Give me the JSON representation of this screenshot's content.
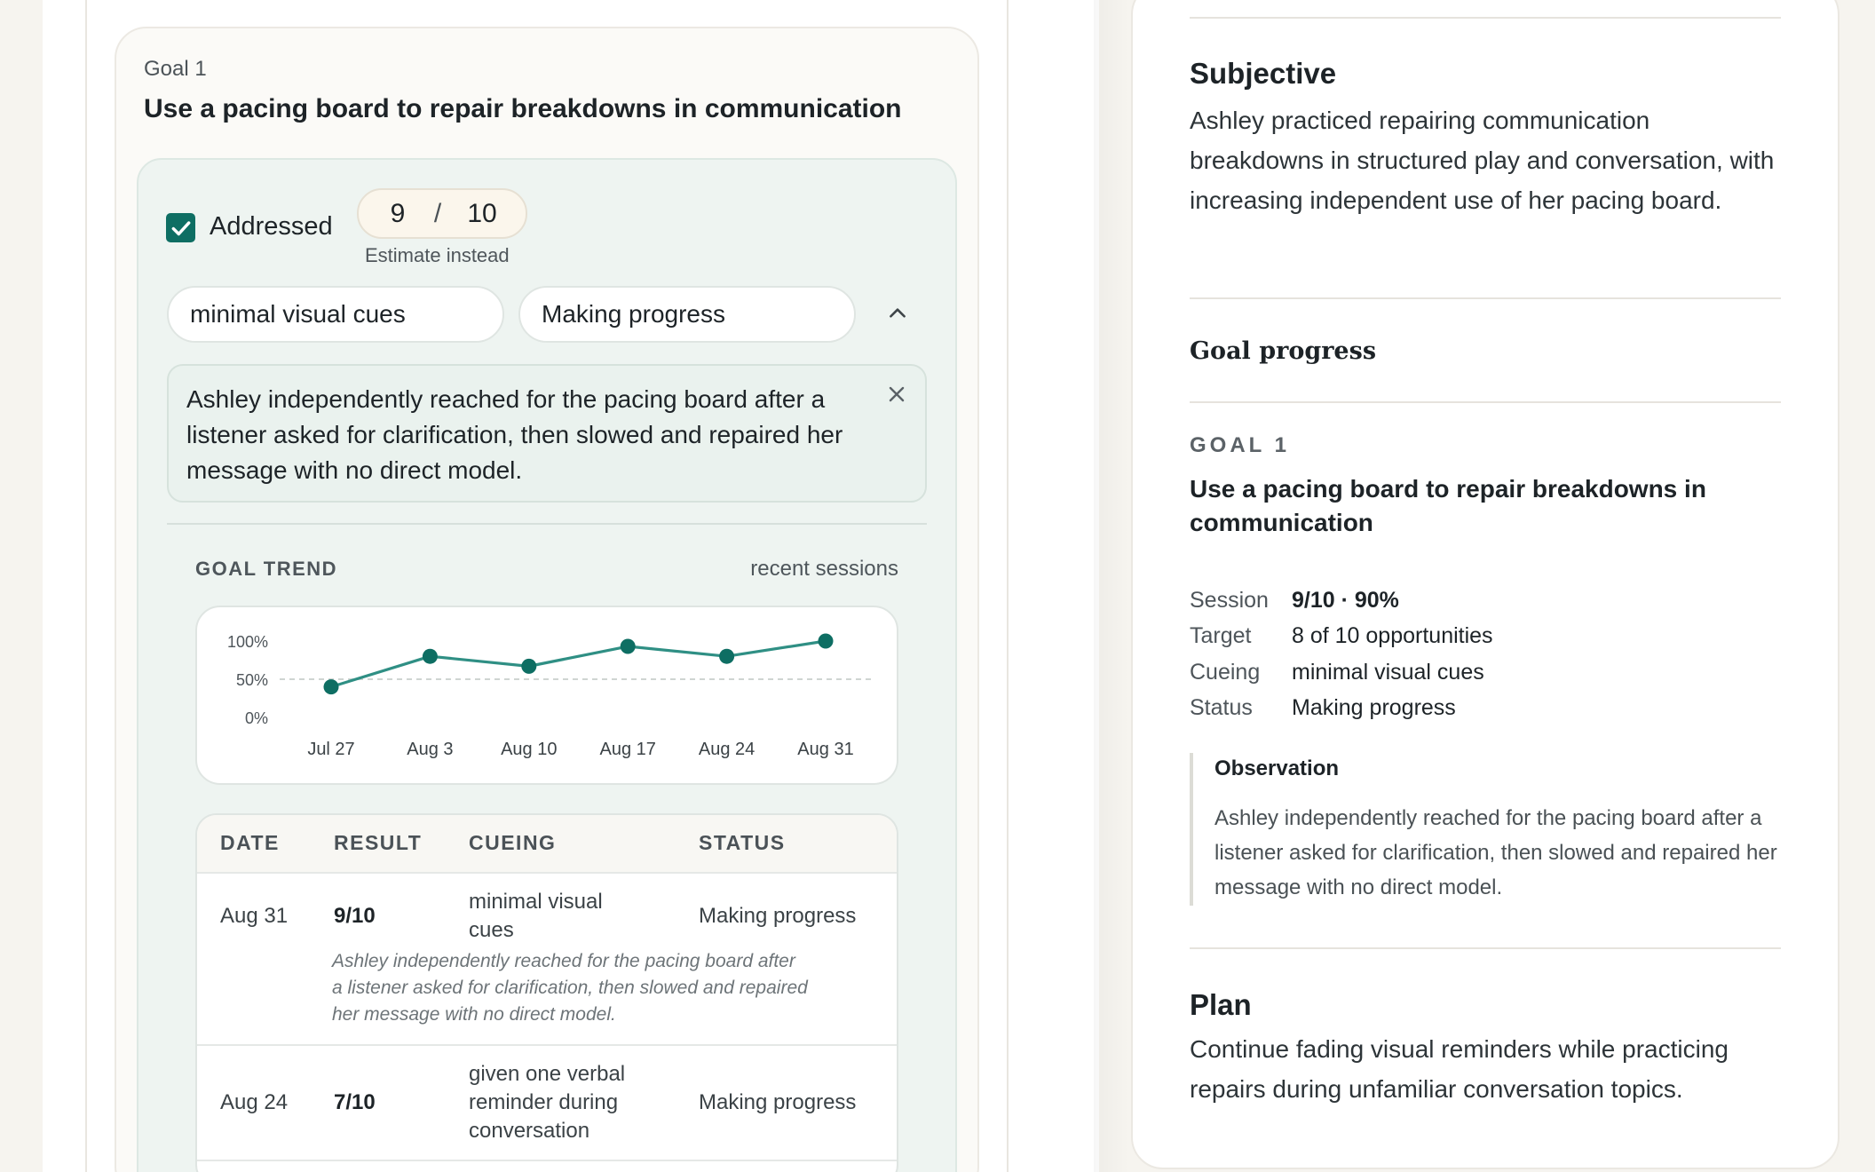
{
  "goal_card": {
    "label": "Goal 1",
    "title": "Use a pacing board to repair breakdowns in communication",
    "addressed_label": "Addressed",
    "addressed_checked": true,
    "score_correct": "9",
    "score_sep": "/",
    "score_total": "10",
    "estimate_link": "Estimate instead",
    "cueing_value": "minimal visual cues",
    "status_value": "Making progress",
    "note": "Ashley independently reached for the pacing board after a listener asked for clarification, then slowed and repaired her message with no direct model."
  },
  "trend": {
    "title": "GOAL TREND",
    "range_label": "recent sessions"
  },
  "chart_data": {
    "type": "line",
    "x": [
      "Jul 27",
      "Aug 3",
      "Aug 10",
      "Aug 17",
      "Aug 24",
      "Aug 31"
    ],
    "series": [
      {
        "values": [
          40,
          80,
          67,
          93,
          80,
          100
        ]
      }
    ],
    "y_tick_labels": [
      "100%",
      "50%",
      "0%"
    ],
    "ylim": [
      0,
      100
    ],
    "reference_line": 50,
    "grid": false,
    "colors": {
      "line": "#2f8f84",
      "point": "#0e6e63",
      "reference": "#cfd5d2"
    }
  },
  "history_table": {
    "headers": [
      "DATE",
      "RESULT",
      "CUEING",
      "STATUS"
    ],
    "rows": [
      {
        "date": "Aug 31",
        "result": "9/10",
        "cueing_line1": "minimal visual",
        "cueing_line2": "cues",
        "status": "Making progress",
        "note_line1": "Ashley independently reached for the pacing board after",
        "note_line2": "a listener asked for clarification, then slowed and repaired",
        "note_line3": "her message with no direct model."
      },
      {
        "date": "Aug 24",
        "result": "7/10",
        "cueing_line1": "given one verbal",
        "cueing_line2": "reminder during",
        "cueing_line3": "conversation",
        "status": "Making progress"
      }
    ]
  },
  "summary": {
    "subjective_heading": "Subjective",
    "subjective_text": "Ashley practiced repairing communication breakdowns in structured play and conversation, with increasing independent use of her pacing board.",
    "goal_progress_heading": "Goal progress",
    "goal_eyebrow": "GOAL 1",
    "goal_title": "Use a pacing board to repair breakdowns in communication",
    "session_key": "Session",
    "session_value": "9/10 · 90%",
    "target_key": "Target",
    "target_value": "8 of 10 opportunities",
    "cueing_key": "Cueing",
    "cueing_value": "minimal visual cues",
    "status_key": "Status",
    "status_value": "Making progress",
    "observation_heading": "Observation",
    "observation_text": "Ashley independently reached for the pacing board after a listener asked for clarification, then slowed and repaired her message with no direct model.",
    "plan_heading": "Plan",
    "plan_text": "Continue fading visual reminders while practicing repairs during unfamiliar conversation topics."
  },
  "colors": {
    "accent": "#0e6e63",
    "page_bg": "#f6f4ef",
    "goal_body_bg": "#eef4f1"
  }
}
